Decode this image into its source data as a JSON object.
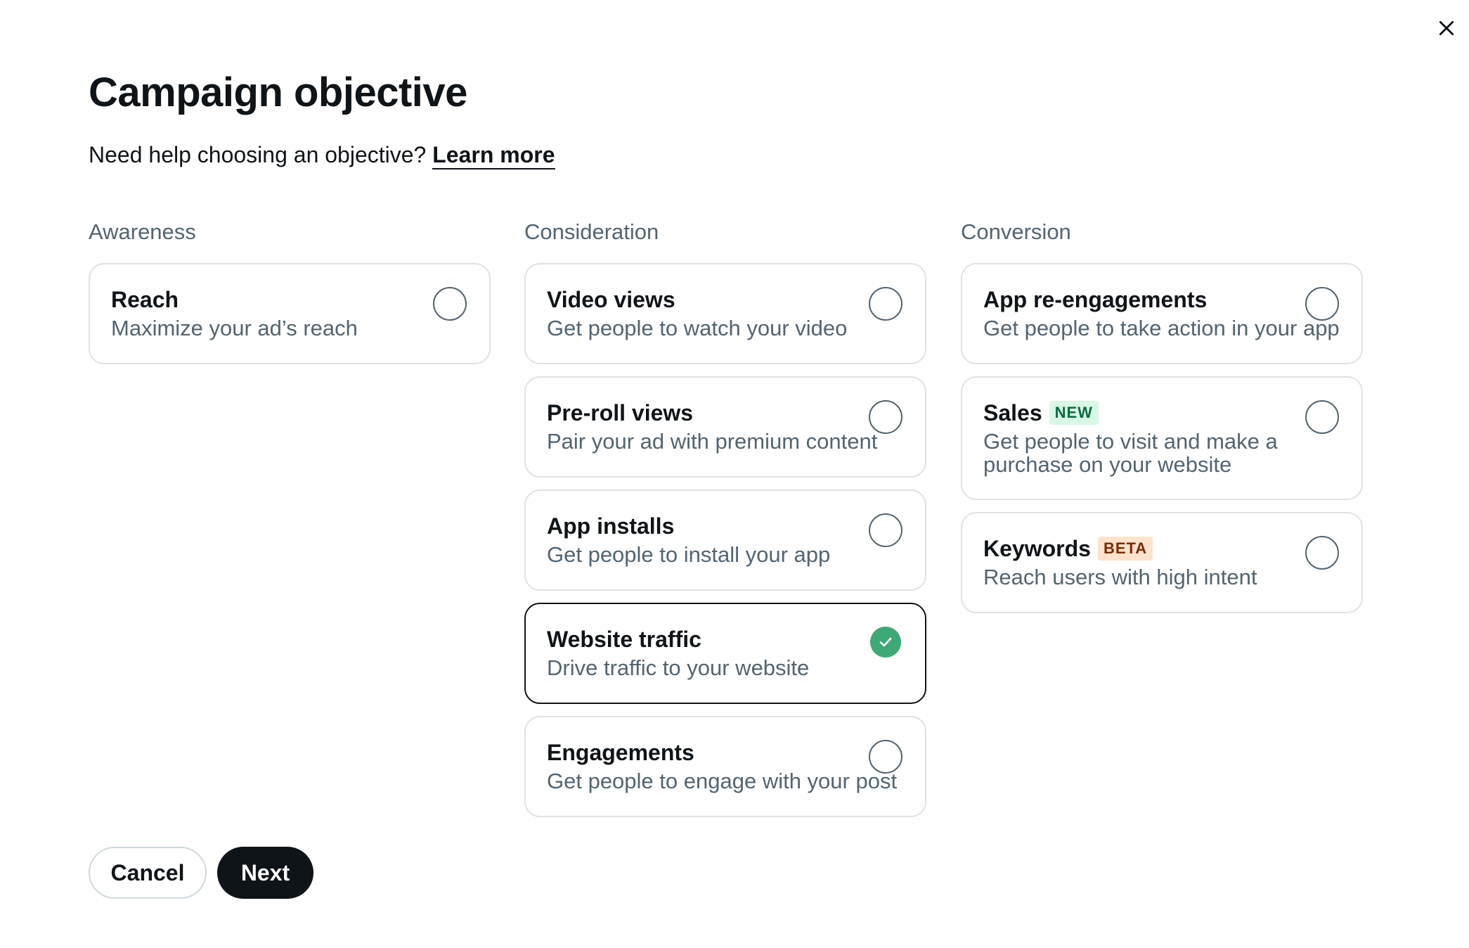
{
  "dialog": {
    "title": "Campaign objective",
    "help_text": "Need help choosing an objective?",
    "help_link": "Learn more"
  },
  "columns": [
    {
      "heading": "Awareness",
      "options": [
        {
          "title": "Reach",
          "description": "Maximize your ad’s reach",
          "badge": "",
          "selected": false
        }
      ]
    },
    {
      "heading": "Consideration",
      "options": [
        {
          "title": "Video views",
          "description": "Get people to watch your video",
          "badge": "",
          "selected": false
        },
        {
          "title": "Pre-roll views",
          "description": "Pair your ad with premium content",
          "badge": "",
          "selected": false
        },
        {
          "title": "App installs",
          "description": "Get people to install your app",
          "badge": "",
          "selected": false
        },
        {
          "title": "Website traffic",
          "description": "Drive traffic to your website",
          "badge": "",
          "selected": true
        },
        {
          "title": "Engagements",
          "description": "Get people to engage with your post",
          "badge": "",
          "selected": false
        }
      ]
    },
    {
      "heading": "Conversion",
      "options": [
        {
          "title": "App re-engagements",
          "description": "Get people to take action in your app",
          "badge": "",
          "selected": false
        },
        {
          "title": "Sales",
          "description": "Get people to visit and make a purchase on your website",
          "badge": "NEW",
          "selected": false
        },
        {
          "title": "Keywords",
          "description": "Reach users with high intent",
          "badge": "BETA",
          "selected": false
        }
      ]
    }
  ],
  "buttons": {
    "cancel": "Cancel",
    "next": "Next"
  },
  "colors": {
    "selected_check": "#3ea876",
    "badge_new_bg": "#d9f7e5",
    "badge_beta_bg": "#fde3cc",
    "primary_button": "#0f1419"
  },
  "icons": {
    "close": "close-icon",
    "check": "checkmark-icon"
  }
}
